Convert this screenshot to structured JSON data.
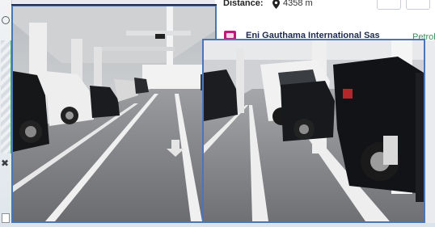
{
  "listing": {
    "distance_label": "Distance:",
    "distance_value": "4358 m",
    "company_name": "Eni Gauthama International Sas",
    "fuel_type": "Petrol"
  },
  "icons": {
    "pin": "map-pin-icon",
    "company": "station-icon",
    "close": "close-icon"
  },
  "sidebar": {
    "close_glyph": "✖"
  },
  "photo": {
    "subject": "parking garage"
  },
  "colors": {
    "accent_border": "#4a76b8",
    "company_icon": "#c2187a",
    "fuel_text": "#3c8d5a",
    "map_route": "#41b06d"
  }
}
